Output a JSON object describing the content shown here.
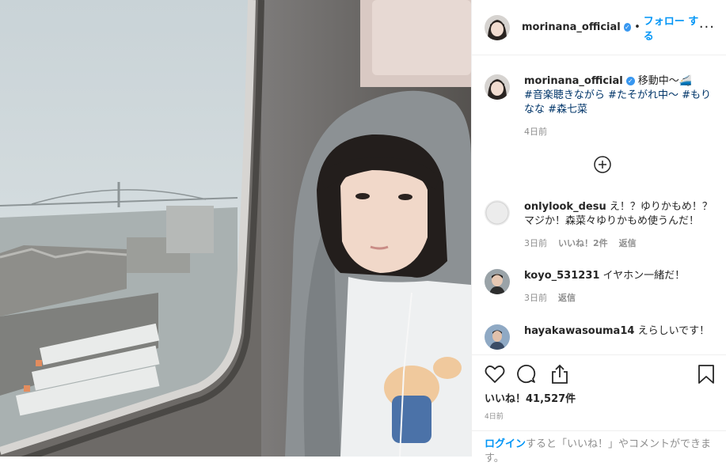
{
  "post": {
    "username": "morinana_official",
    "follow_label": "フォロー する",
    "more_label": "···"
  },
  "caption": {
    "username": "morinana_official",
    "text": "移動中〜🚄",
    "hashtags": [
      "#音楽聴きながら",
      "#たそがれ中〜",
      "#もりなな",
      "#森七菜"
    ],
    "age": "4日前"
  },
  "comments": [
    {
      "username": "onlylook_desu",
      "text": "え！？ゆりかもめ！？マジか！森菜々ゆりかもめ使うんだ！",
      "age": "3日前",
      "likes": "いいね！2件",
      "reply": "返信"
    },
    {
      "username": "koyo_531231",
      "text": "イヤホン一緒だ！",
      "age": "3日前",
      "reply": "返信"
    },
    {
      "username": "hayakawasouma14",
      "text": "えらしいです！"
    }
  ],
  "likes_label": "いいね！41,527件",
  "post_date": "4日前",
  "login": {
    "link": "ログイン",
    "rest": "すると「いいね！」やコメントができます。"
  },
  "icons": {
    "like": "heart-icon",
    "comment": "comment-icon",
    "share": "share-icon",
    "save": "bookmark-icon",
    "load_more": "plus-circle-icon"
  }
}
